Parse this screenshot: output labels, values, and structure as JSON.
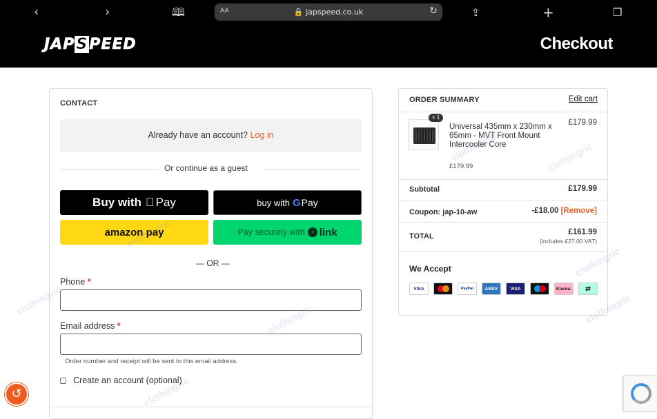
{
  "browser": {
    "url_aa": "AA",
    "url": "japspeed.co.uk"
  },
  "header": {
    "logo_part1": "JAP",
    "logo_s": "S",
    "logo_part2": "PEED",
    "title": "Checkout"
  },
  "contact": {
    "title": "CONTACT",
    "login_prompt": "Already have an account?",
    "login_link": "Log in",
    "guest_divider": "Or continue as a guest",
    "apple_pay_label": "Buy with",
    "apple_pay_brand": "Pay",
    "google_pay_label": "buy with",
    "google_pay_brand": "Pay",
    "amazon_pay_label": "amazon pay",
    "link_pay_label": "Pay securely with",
    "link_pay_brand": "link",
    "or_divider": "— OR —",
    "phone_label": "Phone",
    "email_label": "Email address",
    "required_mark": "*",
    "phone_value": "",
    "email_value": "",
    "email_hint": "Order number and receipt will be sent to this email address.",
    "create_account_label": "Create an account (optional)"
  },
  "summary": {
    "title": "ORDER SUMMARY",
    "edit_cart": "Edit cart",
    "item": {
      "quantity_badge": "× 1",
      "name": "Universal 435mm x 230mm x 65mm - MVT Front Mount Intercooler Core",
      "unit_price": "£179.99",
      "line_price": "£179.99"
    },
    "subtotal_label": "Subtotal",
    "subtotal_value": "£179.99",
    "coupon_label": "Coupon: jap-10-aw",
    "coupon_value": "-£18.00",
    "coupon_remove": "[Remove]",
    "total_label": "TOTAL",
    "total_value": "£161.99",
    "vat_note": "(includes £27.00 VAT)",
    "we_accept": "We Accept",
    "payment_cards": [
      "VISA",
      "mastercard",
      "PayPal",
      "AMEX",
      "VISA",
      "maestro",
      "Klarna.",
      "afterpay"
    ]
  },
  "watermark": "clothingric",
  "colors": {
    "accent": "#e8612c",
    "header_bg": "#000000",
    "link_green": "#00d66f",
    "amazon_yellow": "#ffd814"
  }
}
